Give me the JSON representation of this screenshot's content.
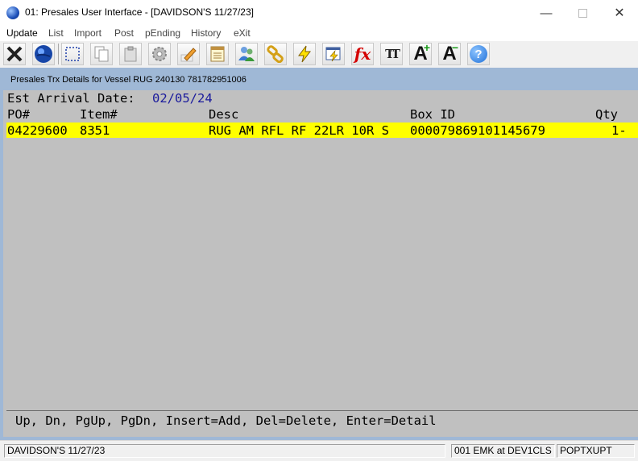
{
  "window": {
    "title": "01: Presales User Interface - [DAVIDSON'S 11/27/23]",
    "minimize": "—",
    "close": "✕"
  },
  "menu": [
    {
      "label": "Update"
    },
    {
      "label": "List"
    },
    {
      "label": "Import"
    },
    {
      "label": "Post"
    },
    {
      "label": "pEnding"
    },
    {
      "label": "History"
    },
    {
      "label": "eXit"
    }
  ],
  "toolbar": {
    "fx_label": "fx",
    "font_label": "TT",
    "font_grow_label": "A",
    "font_shrink_label": "A",
    "help_label": "?"
  },
  "inner": {
    "title": "Presales Trx Details for Vessel  RUG 240130 781782951006",
    "arrival_label": "Est Arrival Date:",
    "arrival_value": "02/05/24",
    "columns": {
      "po": "PO#",
      "item": "Item#",
      "desc": "Desc",
      "box": "Box ID",
      "qty": "Qty"
    },
    "rows": [
      {
        "po": "04229600",
        "item": "8351",
        "desc": "RUG AM RFL RF 22LR 10R S",
        "box": "000079869101145679",
        "qty": "1-"
      }
    ],
    "hint": "Up, Dn, PgUp, PgDn, Insert=Add, Del=Delete, Enter=Detail"
  },
  "status": {
    "company": "DAVIDSON'S 11/27/23",
    "session": "001 EMK at DEV1CLS",
    "program": "POPTXUPT"
  },
  "colors": {
    "selected_row": "#ffff00",
    "panel_bg": "#c0c0c0",
    "frame_bg": "#9fb8d6",
    "date_text": "#1a1a9c"
  }
}
